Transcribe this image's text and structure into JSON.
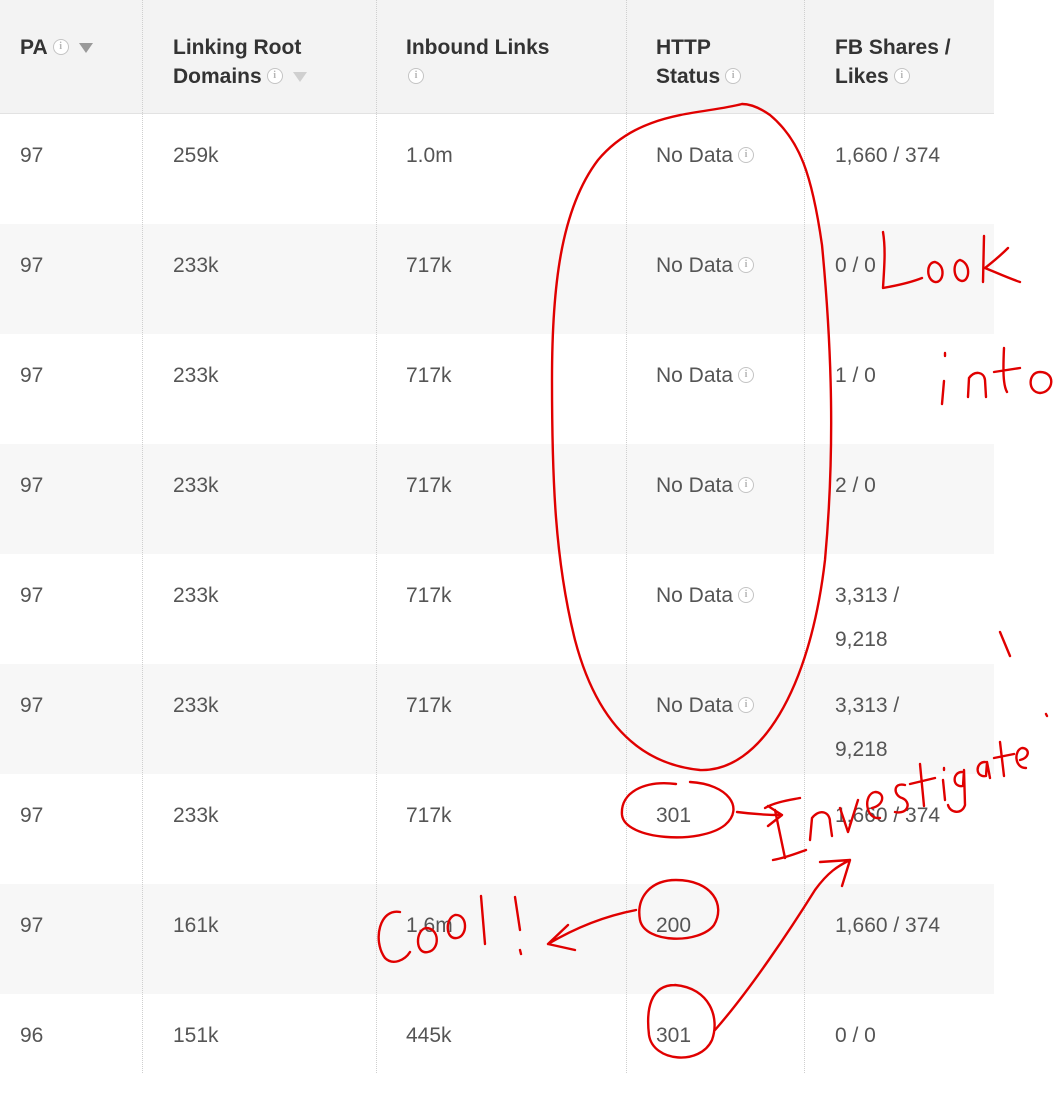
{
  "columns": {
    "pa": "PA",
    "lrd_line1": "Linking Root",
    "lrd_line2": "Domains",
    "inbound": "Inbound Links",
    "http_line1": "HTTP",
    "http_line2": "Status",
    "fb_line1": "FB Shares /",
    "fb_line2": "Likes"
  },
  "info_glyph": "i",
  "rows": [
    {
      "pa": "97",
      "lrd": "259k",
      "inbound": "1.0m",
      "http": "No Data",
      "fb1": "1,660 / 374",
      "fb2": ""
    },
    {
      "pa": "97",
      "lrd": "233k",
      "inbound": "717k",
      "http": "No Data",
      "fb1": "0 / 0",
      "fb2": ""
    },
    {
      "pa": "97",
      "lrd": "233k",
      "inbound": "717k",
      "http": "No Data",
      "fb1": "1 / 0",
      "fb2": ""
    },
    {
      "pa": "97",
      "lrd": "233k",
      "inbound": "717k",
      "http": "No Data",
      "fb1": "2 / 0",
      "fb2": ""
    },
    {
      "pa": "97",
      "lrd": "233k",
      "inbound": "717k",
      "http": "No Data",
      "fb1": "3,313 /",
      "fb2": "9,218"
    },
    {
      "pa": "97",
      "lrd": "233k",
      "inbound": "717k",
      "http": "No Data",
      "fb1": "3,313 /",
      "fb2": "9,218"
    },
    {
      "pa": "97",
      "lrd": "233k",
      "inbound": "717k",
      "http": "301",
      "fb1": "1,660 / 374",
      "fb2": ""
    },
    {
      "pa": "97",
      "lrd": "161k",
      "inbound": "1.6m",
      "http": "200",
      "fb1": "1,660 / 374",
      "fb2": ""
    },
    {
      "pa": "96",
      "lrd": "151k",
      "inbound": "445k",
      "http": "301",
      "fb1": "0 / 0",
      "fb2": ""
    }
  ],
  "annotations": {
    "look_into": "Look into",
    "investigate": "Investigate!",
    "cool": "Cool!",
    "ink_color": "#e00000"
  }
}
